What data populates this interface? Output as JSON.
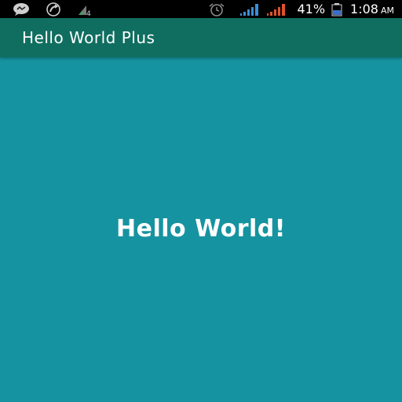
{
  "status_bar": {
    "left_icons": [
      "chat-bubble-icon",
      "missed-call-icon",
      "network-4g-icon"
    ],
    "network_label": "4",
    "right_icons": [
      "alarm-clock-icon",
      "signal-blue-icon",
      "signal-orange-icon",
      "battery-icon"
    ],
    "battery_percent": "41%",
    "time": "1:08",
    "ampm": "AM",
    "colors": {
      "background": "#000000",
      "signal_blue": "#3a8fd8",
      "signal_orange": "#e0522a"
    }
  },
  "app_bar": {
    "title": "Hello World Plus",
    "color": "#106e60"
  },
  "main": {
    "message": "Hello World!",
    "background": "#1693a0"
  }
}
